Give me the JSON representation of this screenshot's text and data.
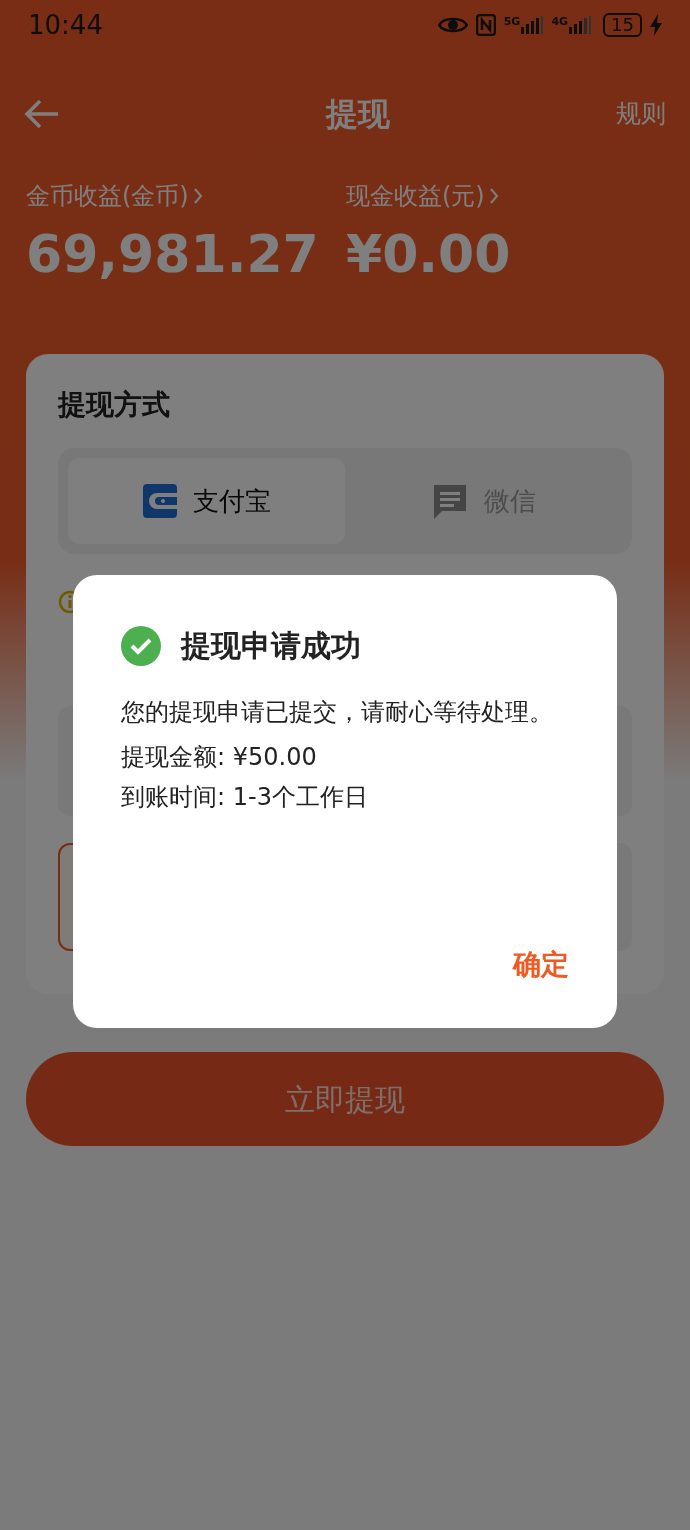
{
  "status_bar": {
    "time": "10:44",
    "network_labels": [
      "5G",
      "4G"
    ],
    "battery": "15"
  },
  "header": {
    "title": "提现",
    "rules": "规则"
  },
  "balances": [
    {
      "label": "金币收益(金币)",
      "value": "69,981.27"
    },
    {
      "label": "现金收益(元)",
      "value": "¥0.00"
    }
  ],
  "method_card": {
    "title": "提现方式",
    "options": [
      {
        "label": "支付宝",
        "kind": "alipay",
        "selected": true
      },
      {
        "label": "微信",
        "kind": "wechat",
        "selected": false
      }
    ]
  },
  "submit_button": "立即提现",
  "dialog": {
    "title": "提现申请成功",
    "message": "您的提现申请已提交，请耐心等待处理。",
    "details": [
      "提现金额: ¥50.00",
      "到账时间: 1-3个工作日"
    ],
    "confirm": "确定"
  }
}
